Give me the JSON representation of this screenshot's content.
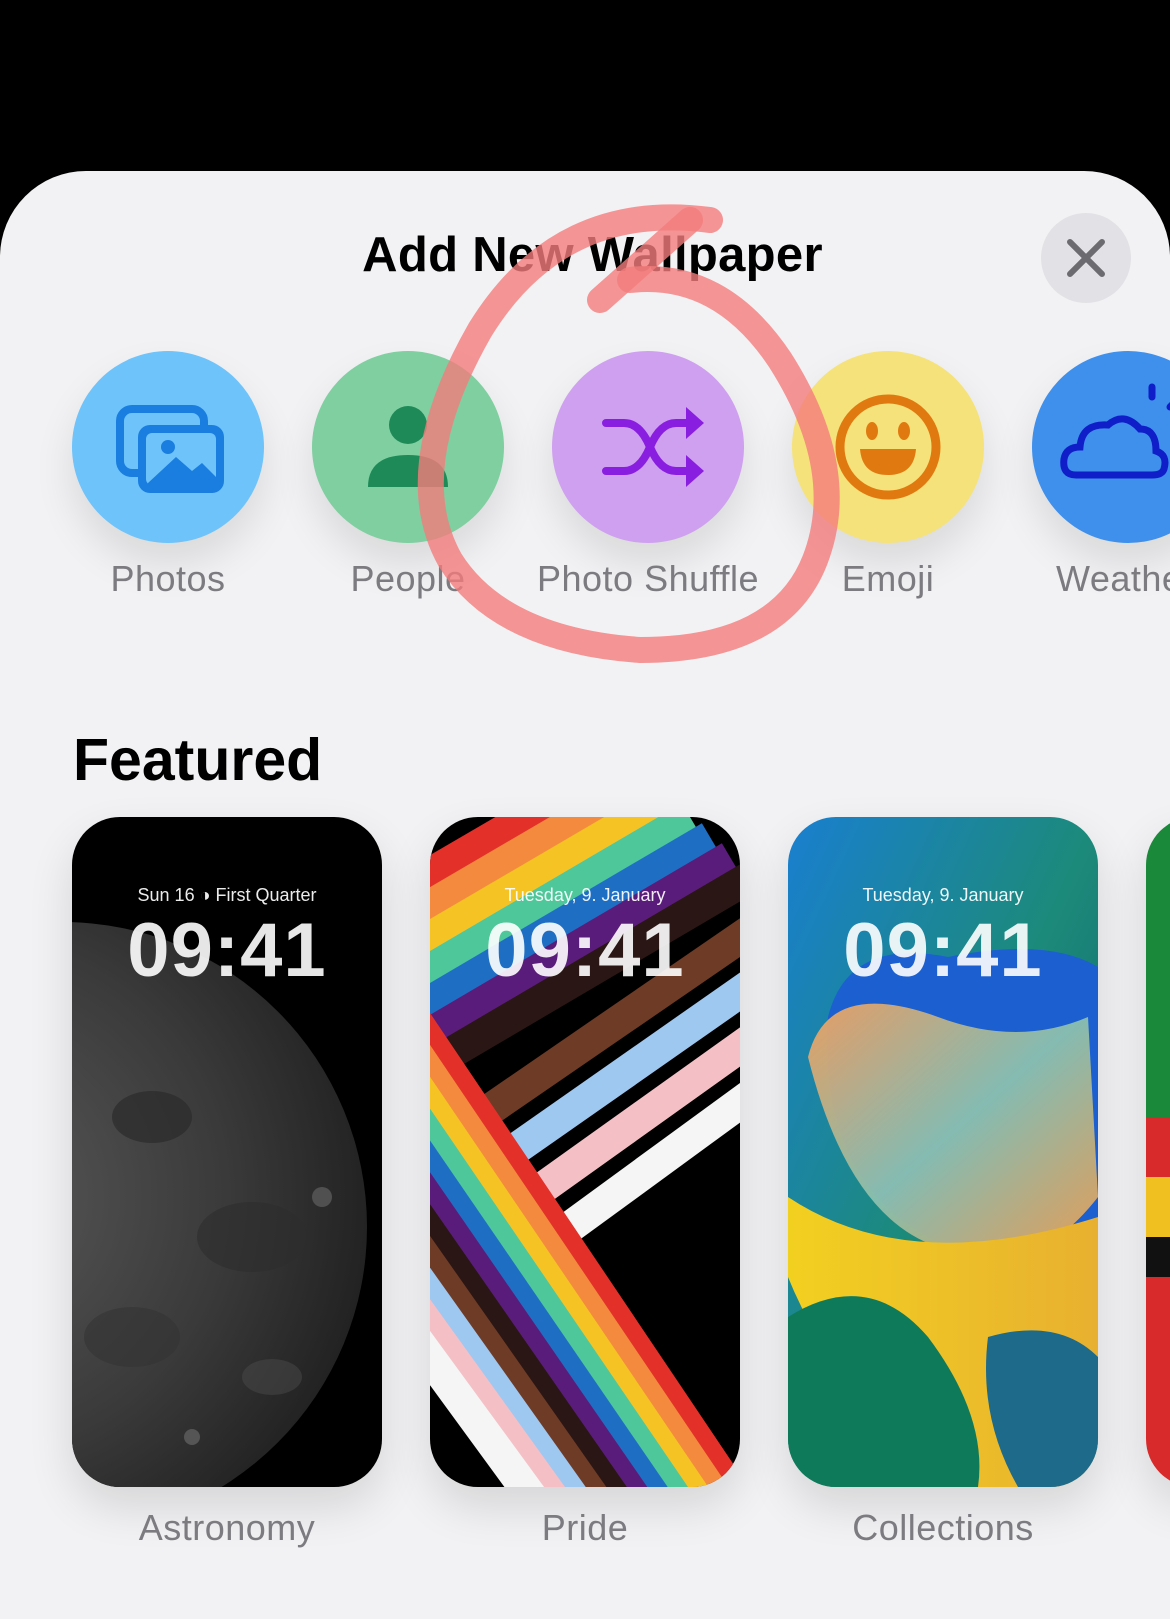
{
  "sheet": {
    "title": "Add New Wallpaper",
    "close_icon": "xmark-icon"
  },
  "categories": [
    {
      "label": "Photos",
      "icon": "photos-icon",
      "color": "#6ec3fa"
    },
    {
      "label": "People",
      "icon": "person-icon",
      "color": "#7fcfa0"
    },
    {
      "label": "Photo Shuffle",
      "icon": "shuffle-icon",
      "color": "#cfa0ef"
    },
    {
      "label": "Emoji",
      "icon": "smiley-icon",
      "color": "#f5e27a"
    },
    {
      "label": "Weathe",
      "icon": "cloud-sun-icon",
      "color": "#3e90ec"
    }
  ],
  "featured": {
    "heading": "Featured",
    "cards": [
      {
        "label": "Astronomy",
        "date": "Sun 16 ◑ First Quarter",
        "time": "09:41"
      },
      {
        "label": "Pride",
        "date": "Tuesday, 9. January",
        "time": "09:41"
      },
      {
        "label": "Collections",
        "date": "Tuesday, 9. January",
        "time": "09:41"
      }
    ]
  },
  "annotation": {
    "color": "#f47c7c",
    "target": "Photo Shuffle"
  }
}
